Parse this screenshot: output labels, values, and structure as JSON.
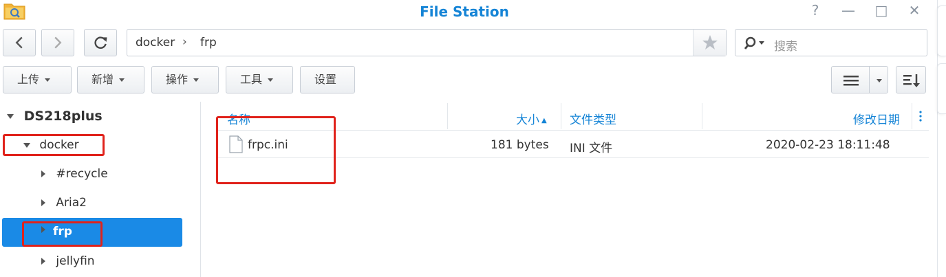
{
  "window": {
    "title": "File Station",
    "help_glyph": "?",
    "min_glyph": "—",
    "max_glyph": "□",
    "close_glyph": "✕"
  },
  "toolbar": {
    "path_segments": [
      "docker",
      "frp"
    ],
    "path_separator": "›",
    "search_placeholder": "搜索",
    "buttons": {
      "upload": "上传",
      "new": "新增",
      "action": "操作",
      "tools": "工具",
      "settings": "设置"
    }
  },
  "sidebar": {
    "root": "DS218plus",
    "items": [
      {
        "label": "docker",
        "expanded": true
      },
      {
        "label": "#recycle"
      },
      {
        "label": "Aria2"
      },
      {
        "label": "frp",
        "selected": true
      },
      {
        "label": "jellyfin"
      }
    ]
  },
  "file_list": {
    "headers": {
      "name": "名称",
      "size": "大小",
      "type": "文件类型",
      "modified": "修改日期"
    },
    "sort_indicator": "▲",
    "rows": [
      {
        "name": "frpc.ini",
        "size": "181 bytes",
        "type": "INI 文件",
        "modified": "2020-02-23 18:11:48"
      }
    ]
  },
  "colors": {
    "accent": "#1584d6",
    "selection": "#1a8ae6",
    "highlight_box": "#e0221b"
  }
}
